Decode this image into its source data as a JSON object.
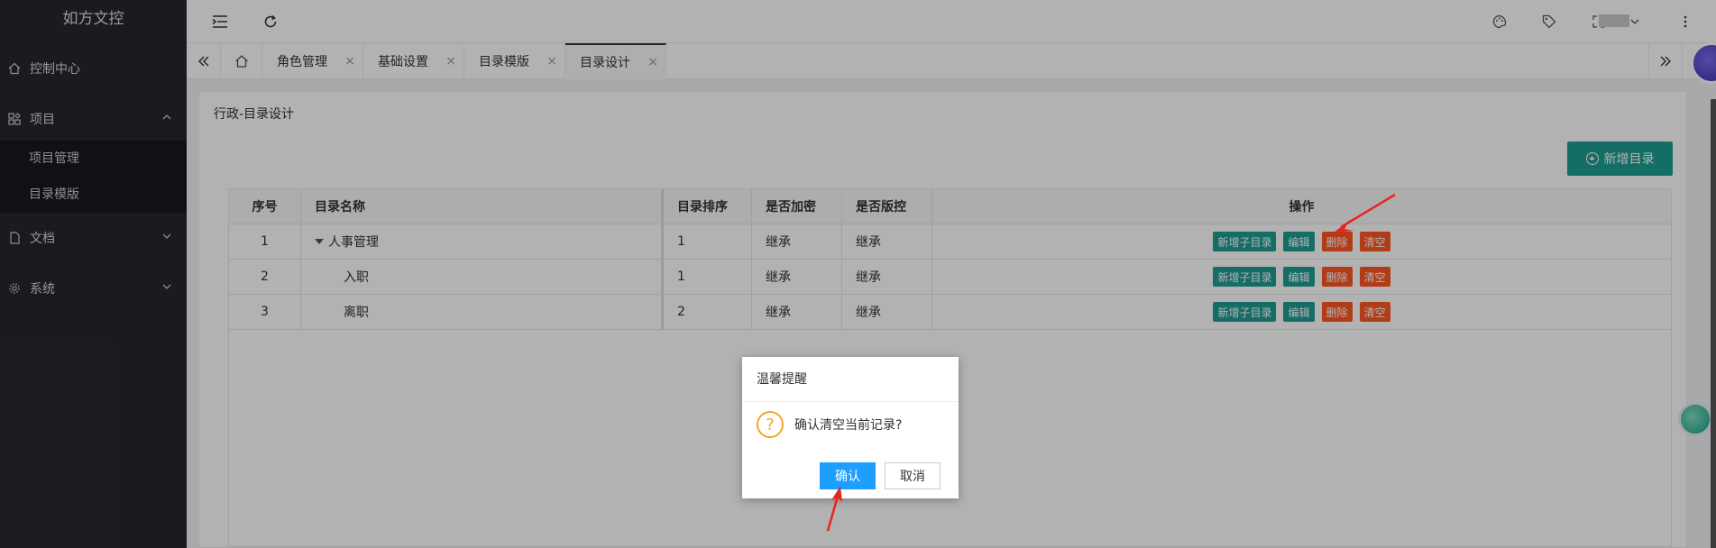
{
  "app": {
    "title": "如方文控"
  },
  "sidebar": {
    "items": [
      {
        "label": "控制中心",
        "icon": "home-icon"
      },
      {
        "label": "项目",
        "icon": "grid-icon",
        "expanded": true
      },
      {
        "label": "文档",
        "icon": "document-icon"
      },
      {
        "label": "系统",
        "icon": "gear-icon"
      }
    ],
    "subitems": [
      {
        "label": "项目管理"
      },
      {
        "label": "目录模版"
      }
    ]
  },
  "tabs": [
    {
      "label": "角色管理"
    },
    {
      "label": "基础设置"
    },
    {
      "label": "目录模版"
    },
    {
      "label": "目录设计",
      "active": true
    }
  ],
  "content": {
    "breadcrumb": "行政-目录设计",
    "add_button": "新增目录"
  },
  "table": {
    "headers": [
      "序号",
      "目录名称",
      "目录排序",
      "是否加密",
      "是否版控",
      "操作"
    ],
    "rows": [
      {
        "seq": "1",
        "name": "人事管理",
        "sort": "1",
        "encrypted": "继承",
        "versioned": "继承"
      },
      {
        "seq": "2",
        "name": "入职",
        "sort": "1",
        "encrypted": "继承",
        "versioned": "继承"
      },
      {
        "seq": "3",
        "name": "离职",
        "sort": "2",
        "encrypted": "继承",
        "versioned": "继承"
      }
    ],
    "ops": {
      "add_child": "新增子目录",
      "edit": "编辑",
      "delete": "删除",
      "clear": "清空"
    }
  },
  "dialog": {
    "title": "温馨提醒",
    "message": "确认清空当前记录?",
    "ok": "确认",
    "cancel": "取消"
  },
  "colors": {
    "sidebar_bg": "#252830",
    "teal": "#1f9e93",
    "orange": "#ff5722",
    "primary": "#1e9fff",
    "warning": "#f5a623",
    "arrow": "#e8251c"
  }
}
